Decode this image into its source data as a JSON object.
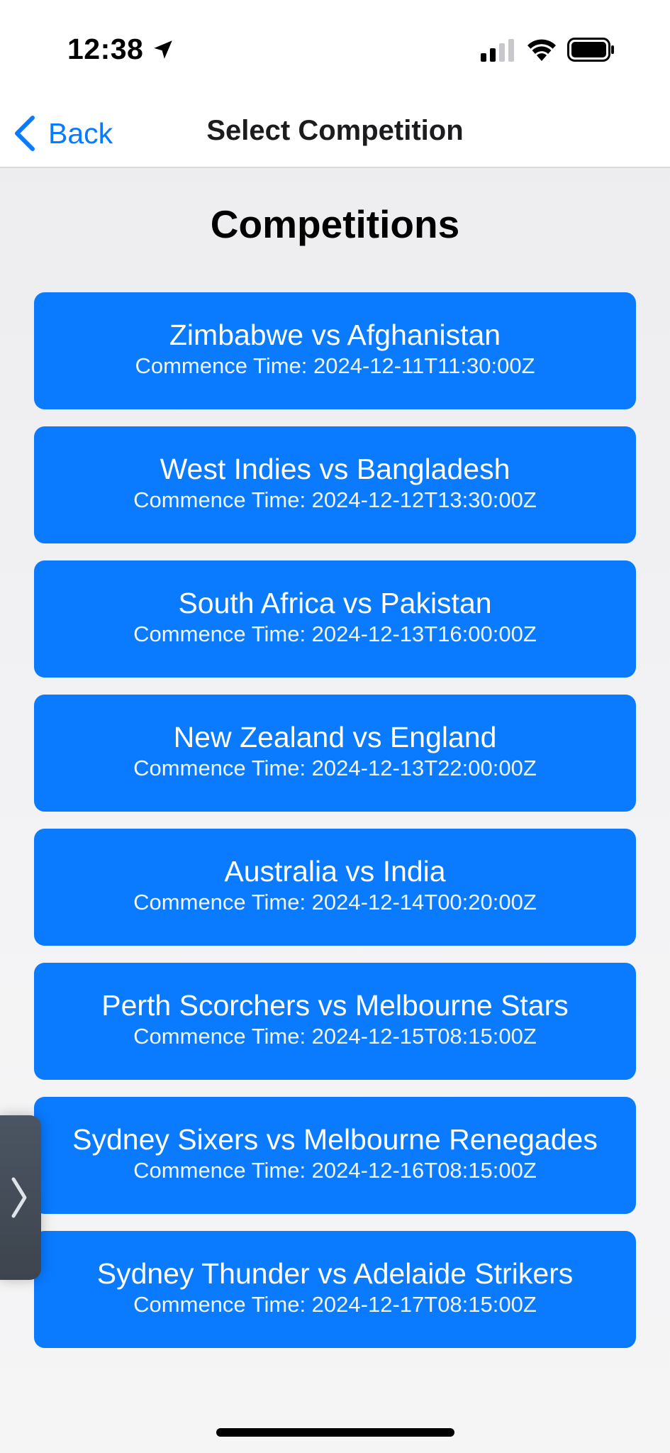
{
  "status_bar": {
    "time": "12:38",
    "icons": [
      "location-arrow-icon",
      "cellular-signal-icon",
      "wifi-icon",
      "battery-icon"
    ]
  },
  "nav": {
    "back_label": "Back",
    "title": "Select Competition"
  },
  "page": {
    "heading": "Competitions"
  },
  "competitions": [
    {
      "title": "Zimbabwe vs Afghanistan",
      "time": "Commence Time: 2024-12-11T11:30:00Z"
    },
    {
      "title": "West Indies vs Bangladesh",
      "time": "Commence Time: 2024-12-12T13:30:00Z"
    },
    {
      "title": "South Africa vs Pakistan",
      "time": "Commence Time: 2024-12-13T16:00:00Z"
    },
    {
      "title": "New Zealand vs England",
      "time": "Commence Time: 2024-12-13T22:00:00Z"
    },
    {
      "title": "Australia vs India",
      "time": "Commence Time: 2024-12-14T00:20:00Z"
    },
    {
      "title": "Perth Scorchers vs Melbourne Stars",
      "time": "Commence Time: 2024-12-15T08:15:00Z"
    },
    {
      "title": "Sydney Sixers vs Melbourne Renegades",
      "time": "Commence Time: 2024-12-16T08:15:00Z"
    },
    {
      "title": "Sydney Thunder vs Adelaide Strikers",
      "time": "Commence Time: 2024-12-17T08:15:00Z"
    }
  ],
  "colors": {
    "accent": "#0a7aff",
    "background": "#f2f2f4",
    "card_text": "#ffffff",
    "side_handle": "#444b55"
  }
}
